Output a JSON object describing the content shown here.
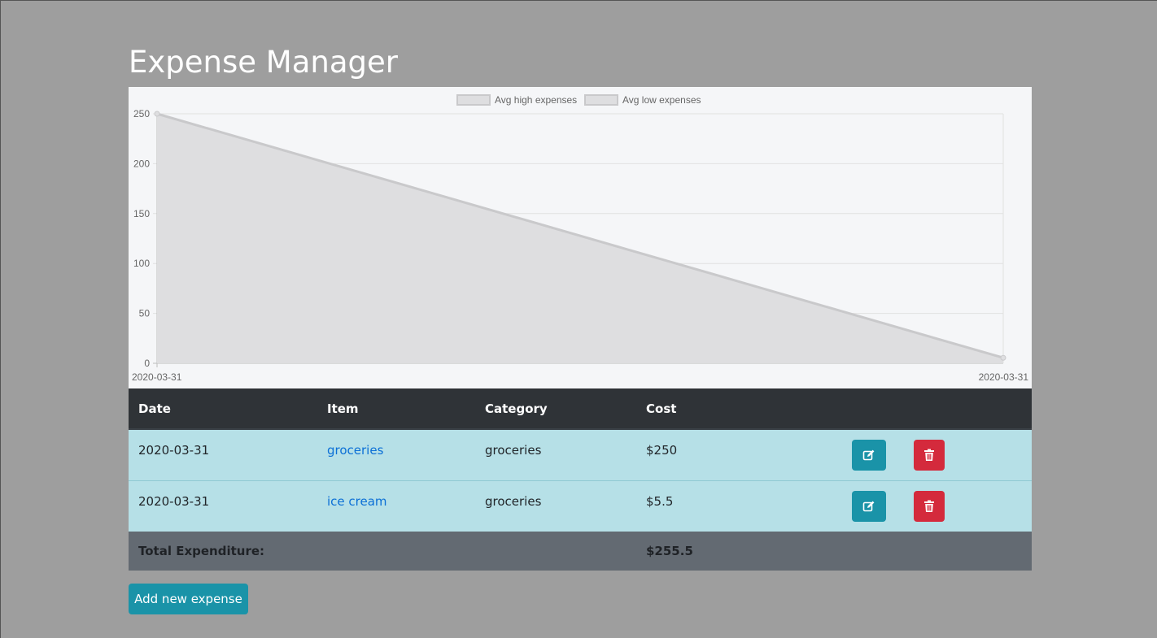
{
  "page": {
    "title": "Expense Manager"
  },
  "chart_data": {
    "type": "area",
    "series": [
      {
        "name": "Avg high expenses",
        "values": [
          250,
          5.5
        ]
      },
      {
        "name": "Avg low expenses",
        "values": []
      }
    ],
    "categories": [
      "2020-03-31",
      "2020-03-31"
    ],
    "yticks": [
      "0",
      "50",
      "100",
      "150",
      "200",
      "250"
    ],
    "ylim": [
      0,
      250
    ],
    "grid": true,
    "legend_position": "top-center",
    "colors": {
      "fill": "#dedee0",
      "line": "#c9c9cb",
      "grid": "#e1e1e1"
    }
  },
  "table": {
    "headers": {
      "date": "Date",
      "item": "Item",
      "category": "Category",
      "cost": "Cost"
    },
    "rows": [
      {
        "date": "2020-03-31",
        "item": "groceries",
        "category": "groceries",
        "cost": "$250"
      },
      {
        "date": "2020-03-31",
        "item": "ice cream",
        "category": "groceries",
        "cost": "$5.5"
      }
    ],
    "total": {
      "label": "Total Expenditure:",
      "value": "$255.5"
    }
  },
  "icons": {
    "edit": "edit-icon",
    "delete": "trash-icon"
  },
  "actions": {
    "add_label": "Add new expense"
  },
  "colors": {
    "background": "#9e9e9e",
    "table_header": "#2f3337",
    "row": "#b6e0e7",
    "total_row": "#636a72",
    "edit_button": "#1a93a8",
    "delete_button": "#d42a3c",
    "link": "#0b6fd6"
  }
}
